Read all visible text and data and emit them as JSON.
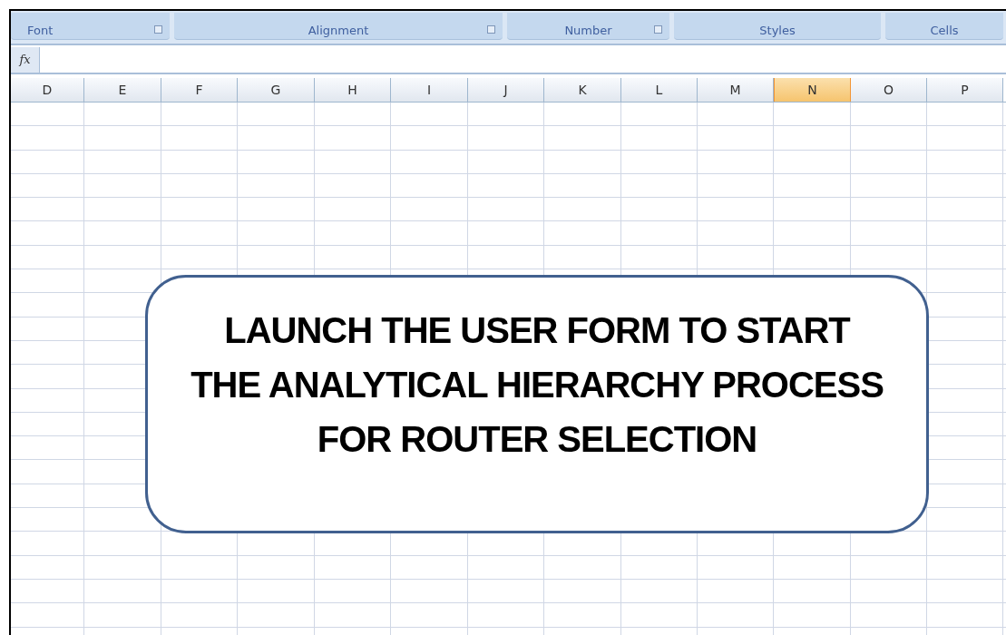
{
  "ribbon_groups": [
    {
      "label": "Font",
      "launcher": true
    },
    {
      "label": "Alignment",
      "launcher": true
    },
    {
      "label": "Number",
      "launcher": true
    },
    {
      "label": "Styles",
      "launcher": false
    },
    {
      "label": "Cells",
      "launcher": false
    }
  ],
  "formula_bar": {
    "function_button": "fx"
  },
  "columns": [
    {
      "label": "D",
      "selected": false
    },
    {
      "label": "E",
      "selected": false
    },
    {
      "label": "F",
      "selected": false
    },
    {
      "label": "G",
      "selected": false
    },
    {
      "label": "H",
      "selected": false
    },
    {
      "label": "I",
      "selected": false
    },
    {
      "label": "J",
      "selected": false
    },
    {
      "label": "K",
      "selected": false
    },
    {
      "label": "L",
      "selected": false
    },
    {
      "label": "M",
      "selected": false
    },
    {
      "label": "N",
      "selected": true
    },
    {
      "label": "O",
      "selected": false
    },
    {
      "label": "P",
      "selected": false
    }
  ],
  "shape": {
    "lines": [
      "LAUNCH THE USER FORM TO START",
      "THE ANALYTICAL HIERARCHY PROCESS",
      "FOR ROUTER SELECTION"
    ]
  }
}
